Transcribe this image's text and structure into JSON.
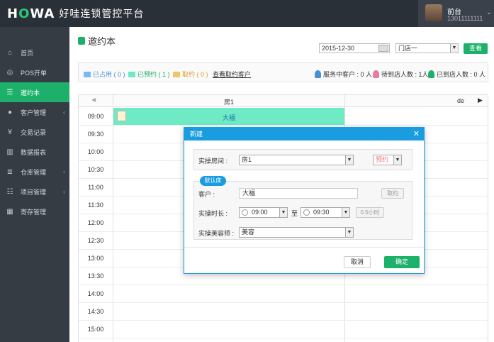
{
  "app": {
    "logo_word_a": "H",
    "logo_word_o": "O",
    "logo_word_b": "WA",
    "title": "好哇连锁管控平台"
  },
  "user": {
    "name": "前台",
    "phone": "13011111111"
  },
  "sidebar": {
    "items": [
      {
        "label": "首页",
        "icon": "home-icon"
      },
      {
        "label": "POS开单",
        "icon": "pos-icon"
      },
      {
        "label": "邀约本",
        "icon": "book-icon",
        "active": true
      },
      {
        "label": "客户管理",
        "icon": "user-icon",
        "has_arrow": true
      },
      {
        "label": "交易记录",
        "icon": "yen-icon"
      },
      {
        "label": "数据报表",
        "icon": "chart-icon"
      },
      {
        "label": "仓库管理",
        "icon": "database-icon",
        "has_arrow": true
      },
      {
        "label": "项目管理",
        "icon": "list-icon",
        "has_arrow": true
      },
      {
        "label": "寄存管理",
        "icon": "storage-icon"
      }
    ]
  },
  "page": {
    "title": "邀约本"
  },
  "toolbar": {
    "date": "2015-12-30",
    "store": "门店一",
    "search_label": "查看"
  },
  "legend": {
    "occupied": "已占用 ( 0 )",
    "booked": "已预约 ( 1 )",
    "cancelled": "取约 ( 0 )",
    "view_cancelled": "查看取约客户",
    "serving": "服务中客户 : 0 人",
    "waiting": "待到店人数 : 1人",
    "arrived": "已到店人数 : 0 人"
  },
  "colors": {
    "occupied": "#7fb7ef",
    "booked": "#6eeac5",
    "cancelled": "#f2c46b",
    "accent": "#1cb06a",
    "dialog": "#1a9de0"
  },
  "grid": {
    "prev": "◀",
    "next": "▶",
    "room1": "房1",
    "room2": "de",
    "times": [
      "09:00",
      "09:30",
      "10:00",
      "10:30",
      "11:00",
      "11:30",
      "12:00",
      "12:30",
      "13:00",
      "13:30",
      "14:00",
      "14:30",
      "15:00"
    ],
    "booking": {
      "customer": "大福"
    }
  },
  "dialog": {
    "title": "新建",
    "room_label": "实操房间 :",
    "room_value": "房1",
    "status_value": "预约",
    "default_bed": "默认床",
    "customer_label": "客户 :",
    "customer_value": "大福",
    "cancel_booking": "取约",
    "duration_label": "实操时长 :",
    "start_time": "09:00",
    "to": "至",
    "end_time": "09:30",
    "duration": "0.5小时",
    "beautician_label": "实操美容师 :",
    "beautician_value": "美容",
    "cancel_label": "取消",
    "confirm_label": "确定"
  }
}
